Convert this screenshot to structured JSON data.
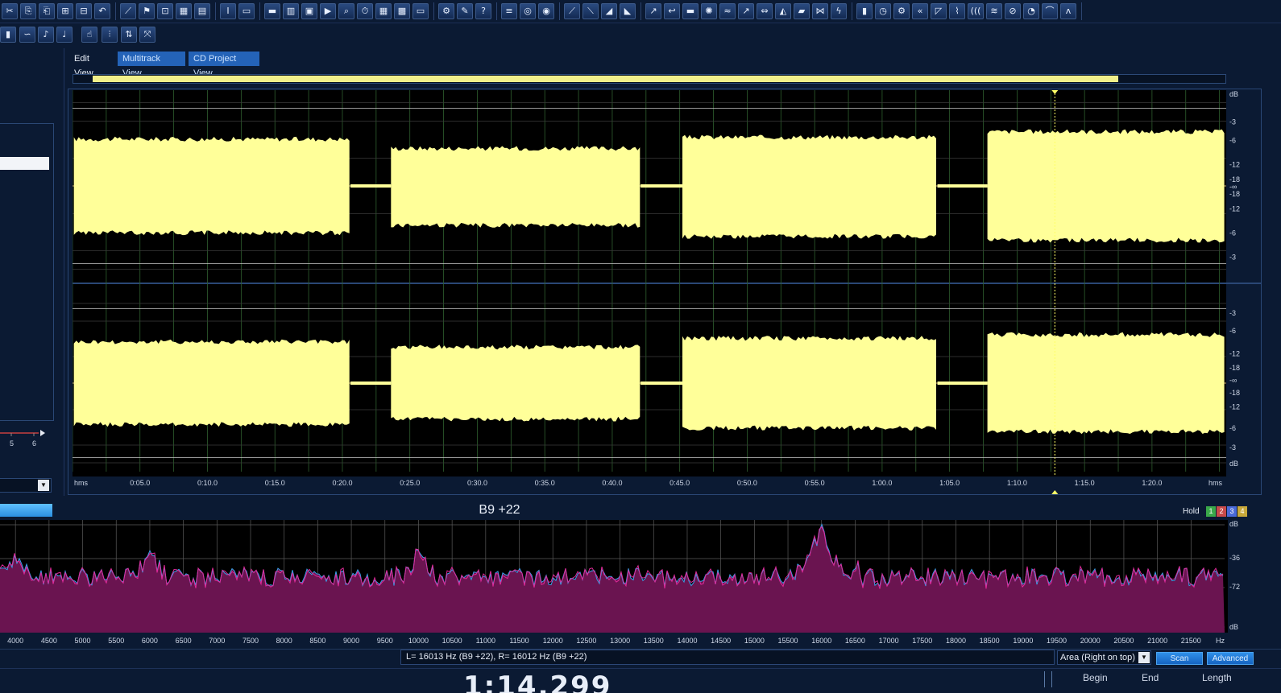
{
  "toolbar": {
    "buttons": [
      {
        "name": "cut-icon",
        "glyph": "✂"
      },
      {
        "name": "copy-icon",
        "glyph": "⎘"
      },
      {
        "name": "paste-icon",
        "glyph": "⎗"
      },
      {
        "name": "mix-paste-icon",
        "glyph": "⊞"
      },
      {
        "name": "trim-icon",
        "glyph": "⊟"
      },
      {
        "name": "undo-icon",
        "glyph": "↶"
      },
      {
        "name": "draw-icon",
        "glyph": "⟋"
      },
      {
        "name": "marker-icon",
        "glyph": "⚑"
      },
      {
        "name": "snap-icon",
        "glyph": "⊡"
      },
      {
        "name": "grid-icon",
        "glyph": "▦"
      },
      {
        "name": "table-icon",
        "glyph": "▤"
      },
      {
        "name": "cursor-icon",
        "glyph": "I"
      },
      {
        "name": "select-rect-icon",
        "glyph": "▭"
      },
      {
        "name": "waveform-view-icon",
        "glyph": "▬"
      },
      {
        "name": "spectral-view-icon",
        "glyph": "▥"
      },
      {
        "name": "pan-view-icon",
        "glyph": "▣"
      },
      {
        "name": "play-icon",
        "glyph": "▶"
      },
      {
        "name": "zoom-icon",
        "glyph": "⌕"
      },
      {
        "name": "timecode-icon",
        "glyph": "⏱"
      },
      {
        "name": "meter-icon",
        "glyph": "▦"
      },
      {
        "name": "palette-icon",
        "glyph": "▩"
      },
      {
        "name": "blank-icon",
        "glyph": "▭"
      },
      {
        "name": "settings-icon",
        "glyph": "⚙"
      },
      {
        "name": "tools-icon",
        "glyph": "✎"
      },
      {
        "name": "help-icon",
        "glyph": "?"
      },
      {
        "name": "equalizer-icon",
        "glyph": "≡"
      },
      {
        "name": "analysis-icon",
        "glyph": "◎"
      },
      {
        "name": "record-icon",
        "glyph": "◉"
      },
      {
        "name": "envelope-icon",
        "glyph": "⟋"
      },
      {
        "name": "fade-icon",
        "glyph": "⟍"
      },
      {
        "name": "gain-icon",
        "glyph": "◢"
      },
      {
        "name": "normalize-icon",
        "glyph": "◣"
      },
      {
        "name": "amplify-icon",
        "glyph": "↗"
      },
      {
        "name": "reverse-icon",
        "glyph": "↩"
      },
      {
        "name": "silence-icon",
        "glyph": "▬"
      },
      {
        "name": "noise-icon",
        "glyph": "✺"
      },
      {
        "name": "wave-icon",
        "glyph": "≈"
      },
      {
        "name": "pitch-icon",
        "glyph": "↗"
      },
      {
        "name": "stretch-icon",
        "glyph": "⇔"
      },
      {
        "name": "filter-icon",
        "glyph": "◭"
      },
      {
        "name": "spectrum-icon",
        "glyph": "▰"
      },
      {
        "name": "compress-icon",
        "glyph": "⋈"
      },
      {
        "name": "chorus-icon",
        "glyph": "ϟ"
      },
      {
        "name": "bars-icon",
        "glyph": "▮"
      },
      {
        "name": "timer-icon",
        "glyph": "◷"
      },
      {
        "name": "gear-icon",
        "glyph": "⚙"
      },
      {
        "name": "delay-icon",
        "glyph": "«"
      },
      {
        "name": "echo-icon",
        "glyph": "◸"
      },
      {
        "name": "reverb-icon",
        "glyph": "⌇"
      },
      {
        "name": "flange-icon",
        "glyph": "((("
      },
      {
        "name": "wah-icon",
        "glyph": "≋"
      },
      {
        "name": "mute-icon",
        "glyph": "⊘"
      },
      {
        "name": "phaser-icon",
        "glyph": "◔"
      },
      {
        "name": "signal-icon",
        "glyph": "⌒"
      },
      {
        "name": "sweep-icon",
        "glyph": "ʌ"
      }
    ],
    "row2": [
      {
        "name": "channel-icon",
        "glyph": "▮"
      },
      {
        "name": "loop-icon",
        "glyph": "∽"
      },
      {
        "name": "note-icon",
        "glyph": "♪"
      },
      {
        "name": "note2-icon",
        "glyph": "♩"
      },
      {
        "name": "hand-icon",
        "glyph": "☝"
      },
      {
        "name": "split-icon",
        "glyph": "⫶"
      },
      {
        "name": "snap-to-icon",
        "glyph": "⇅"
      },
      {
        "name": "fit-icon",
        "glyph": "⤧"
      }
    ]
  },
  "tabs": {
    "edit": "Edit View",
    "multitrack": "Multitrack View",
    "cd_project": "CD Project View"
  },
  "left_panel": {
    "scale_labels": [
      "5",
      "6"
    ]
  },
  "waveform": {
    "colors": {
      "wave": "#ffff99",
      "grid": "#2f5f2f",
      "center": "#d8b870",
      "background": "#000000",
      "cursor": "#ffff66"
    },
    "ruler_start": "hms",
    "ruler_end": "hms",
    "time_ticks": [
      "0:05.0",
      "0:10.0",
      "0:15.0",
      "0:20.0",
      "0:25.0",
      "0:30.0",
      "0:35.0",
      "0:40.0",
      "0:45.0",
      "0:50.0",
      "0:55.0",
      "1:00.0",
      "1:05.0",
      "1:10.0",
      "1:15.0",
      "1:20.0"
    ],
    "db_labels_ch1": [
      "dB",
      "-3",
      "-6",
      "-12",
      "-18",
      "-∞",
      "-18",
      "-12",
      "-6",
      "-3"
    ],
    "db_labels_ch2": [
      "-3",
      "-6",
      "-12",
      "-18",
      "-∞",
      "-18",
      "-12",
      "-6",
      "-3",
      "dB"
    ],
    "duration_s": 85.5,
    "cursor_s": 72.8,
    "segments": [
      {
        "start_s": 0.1,
        "end_s": 20.6,
        "ch1_top": 0.26,
        "ch1_bottom": 0.26,
        "ch2_top": 0.28,
        "ch2_bottom": 0.28
      },
      {
        "start_s": 23.6,
        "end_s": 42.1,
        "ch1_top": 0.31,
        "ch1_bottom": 0.3,
        "ch2_top": 0.31,
        "ch2_bottom": 0.31
      },
      {
        "start_s": 45.2,
        "end_s": 64.1,
        "ch1_top": 0.25,
        "ch1_bottom": 0.24,
        "ch2_top": 0.26,
        "ch2_bottom": 0.26
      },
      {
        "start_s": 67.8,
        "end_s": 85.5,
        "ch1_top": 0.22,
        "ch1_bottom": 0.22,
        "ch2_top": 0.24,
        "ch2_bottom": 0.24
      }
    ]
  },
  "frequency_analysis": {
    "title": "B9 +22",
    "hold_label": "Hold",
    "hold_buttons": [
      {
        "label": "1",
        "color": "#3aa84a"
      },
      {
        "label": "2",
        "color": "#c84a4a"
      },
      {
        "label": "3",
        "color": "#4a6ad8"
      },
      {
        "label": "4",
        "color": "#c8a83a"
      }
    ],
    "colors": {
      "fill": "#6a1450",
      "line_l": "#3aa0e8",
      "line_r": "#e02a9a",
      "grid": "#5a5a5a"
    },
    "freq_ticks": [
      "4000",
      "4500",
      "5000",
      "5500",
      "6000",
      "6500",
      "7000",
      "7500",
      "8000",
      "8500",
      "9000",
      "9500",
      "10000",
      "10500",
      "11000",
      "11500",
      "12000",
      "12500",
      "13000",
      "13500",
      "14000",
      "14500",
      "15000",
      "15500",
      "16000",
      "16500",
      "17000",
      "17500",
      "18000",
      "18500",
      "19000",
      "19500",
      "20000",
      "20500",
      "21000",
      "21500"
    ],
    "unit": "Hz",
    "db_labels": [
      "dB",
      "-36",
      "-72",
      "dB"
    ],
    "peaks_hz": [
      4000,
      6000,
      10000,
      16000
    ],
    "readout": "L=  16013 Hz (B9 +22), R=  16012 Hz (B9 +22)",
    "area_mode": "Area (Right on top)",
    "scan_label": "Scan",
    "advanced_label": "Advanced"
  },
  "bottom": {
    "time_display": "1:14.299",
    "begin_label": "Begin",
    "end_label": "End",
    "length_label": "Length"
  }
}
